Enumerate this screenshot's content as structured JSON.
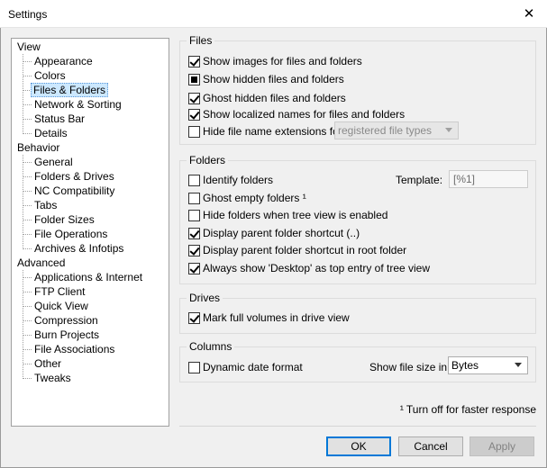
{
  "window": {
    "title": "Settings"
  },
  "tree": {
    "categories": [
      {
        "label": "View",
        "children": [
          "Appearance",
          "Colors",
          "Files & Folders",
          "Network & Sorting",
          "Status Bar",
          "Details"
        ]
      },
      {
        "label": "Behavior",
        "children": [
          "General",
          "Folders & Drives",
          "NC Compatibility",
          "Tabs",
          "Folder Sizes",
          "File Operations",
          "Archives & Infotips"
        ]
      },
      {
        "label": "Advanced",
        "children": [
          "Applications & Internet",
          "FTP Client",
          "Quick View",
          "Compression",
          "Burn Projects",
          "File Associations",
          "Other",
          "Tweaks"
        ]
      }
    ],
    "selected": "Files & Folders"
  },
  "files": {
    "legend": "Files",
    "show_images": "Show images for files and folders",
    "show_hidden": "Show hidden files and folders",
    "ghost_hidden": "Ghost hidden files and folders",
    "show_localized": "Show localized names for files and folders",
    "hide_ext": "Hide file name extensions for",
    "hide_ext_dropdown": "registered file types"
  },
  "folders": {
    "legend": "Folders",
    "identify": "Identify folders",
    "template_label": "Template:",
    "template_value": "[%1]",
    "ghost_empty": "Ghost empty folders ¹",
    "hide_when_tree": "Hide folders when tree view is enabled",
    "display_parent": "Display parent folder shortcut (..)",
    "display_parent_root": "Display parent folder shortcut in root folder",
    "always_desktop": "Always show 'Desktop' as top entry of tree view"
  },
  "drives": {
    "legend": "Drives",
    "mark_full": "Mark full volumes in drive view"
  },
  "columns": {
    "legend": "Columns",
    "dynamic_date": "Dynamic date format",
    "size_label": "Show file size in:",
    "size_value": "Bytes"
  },
  "footnote": "¹ Turn off for faster response",
  "buttons": {
    "ok": "OK",
    "cancel": "Cancel",
    "apply": "Apply"
  }
}
